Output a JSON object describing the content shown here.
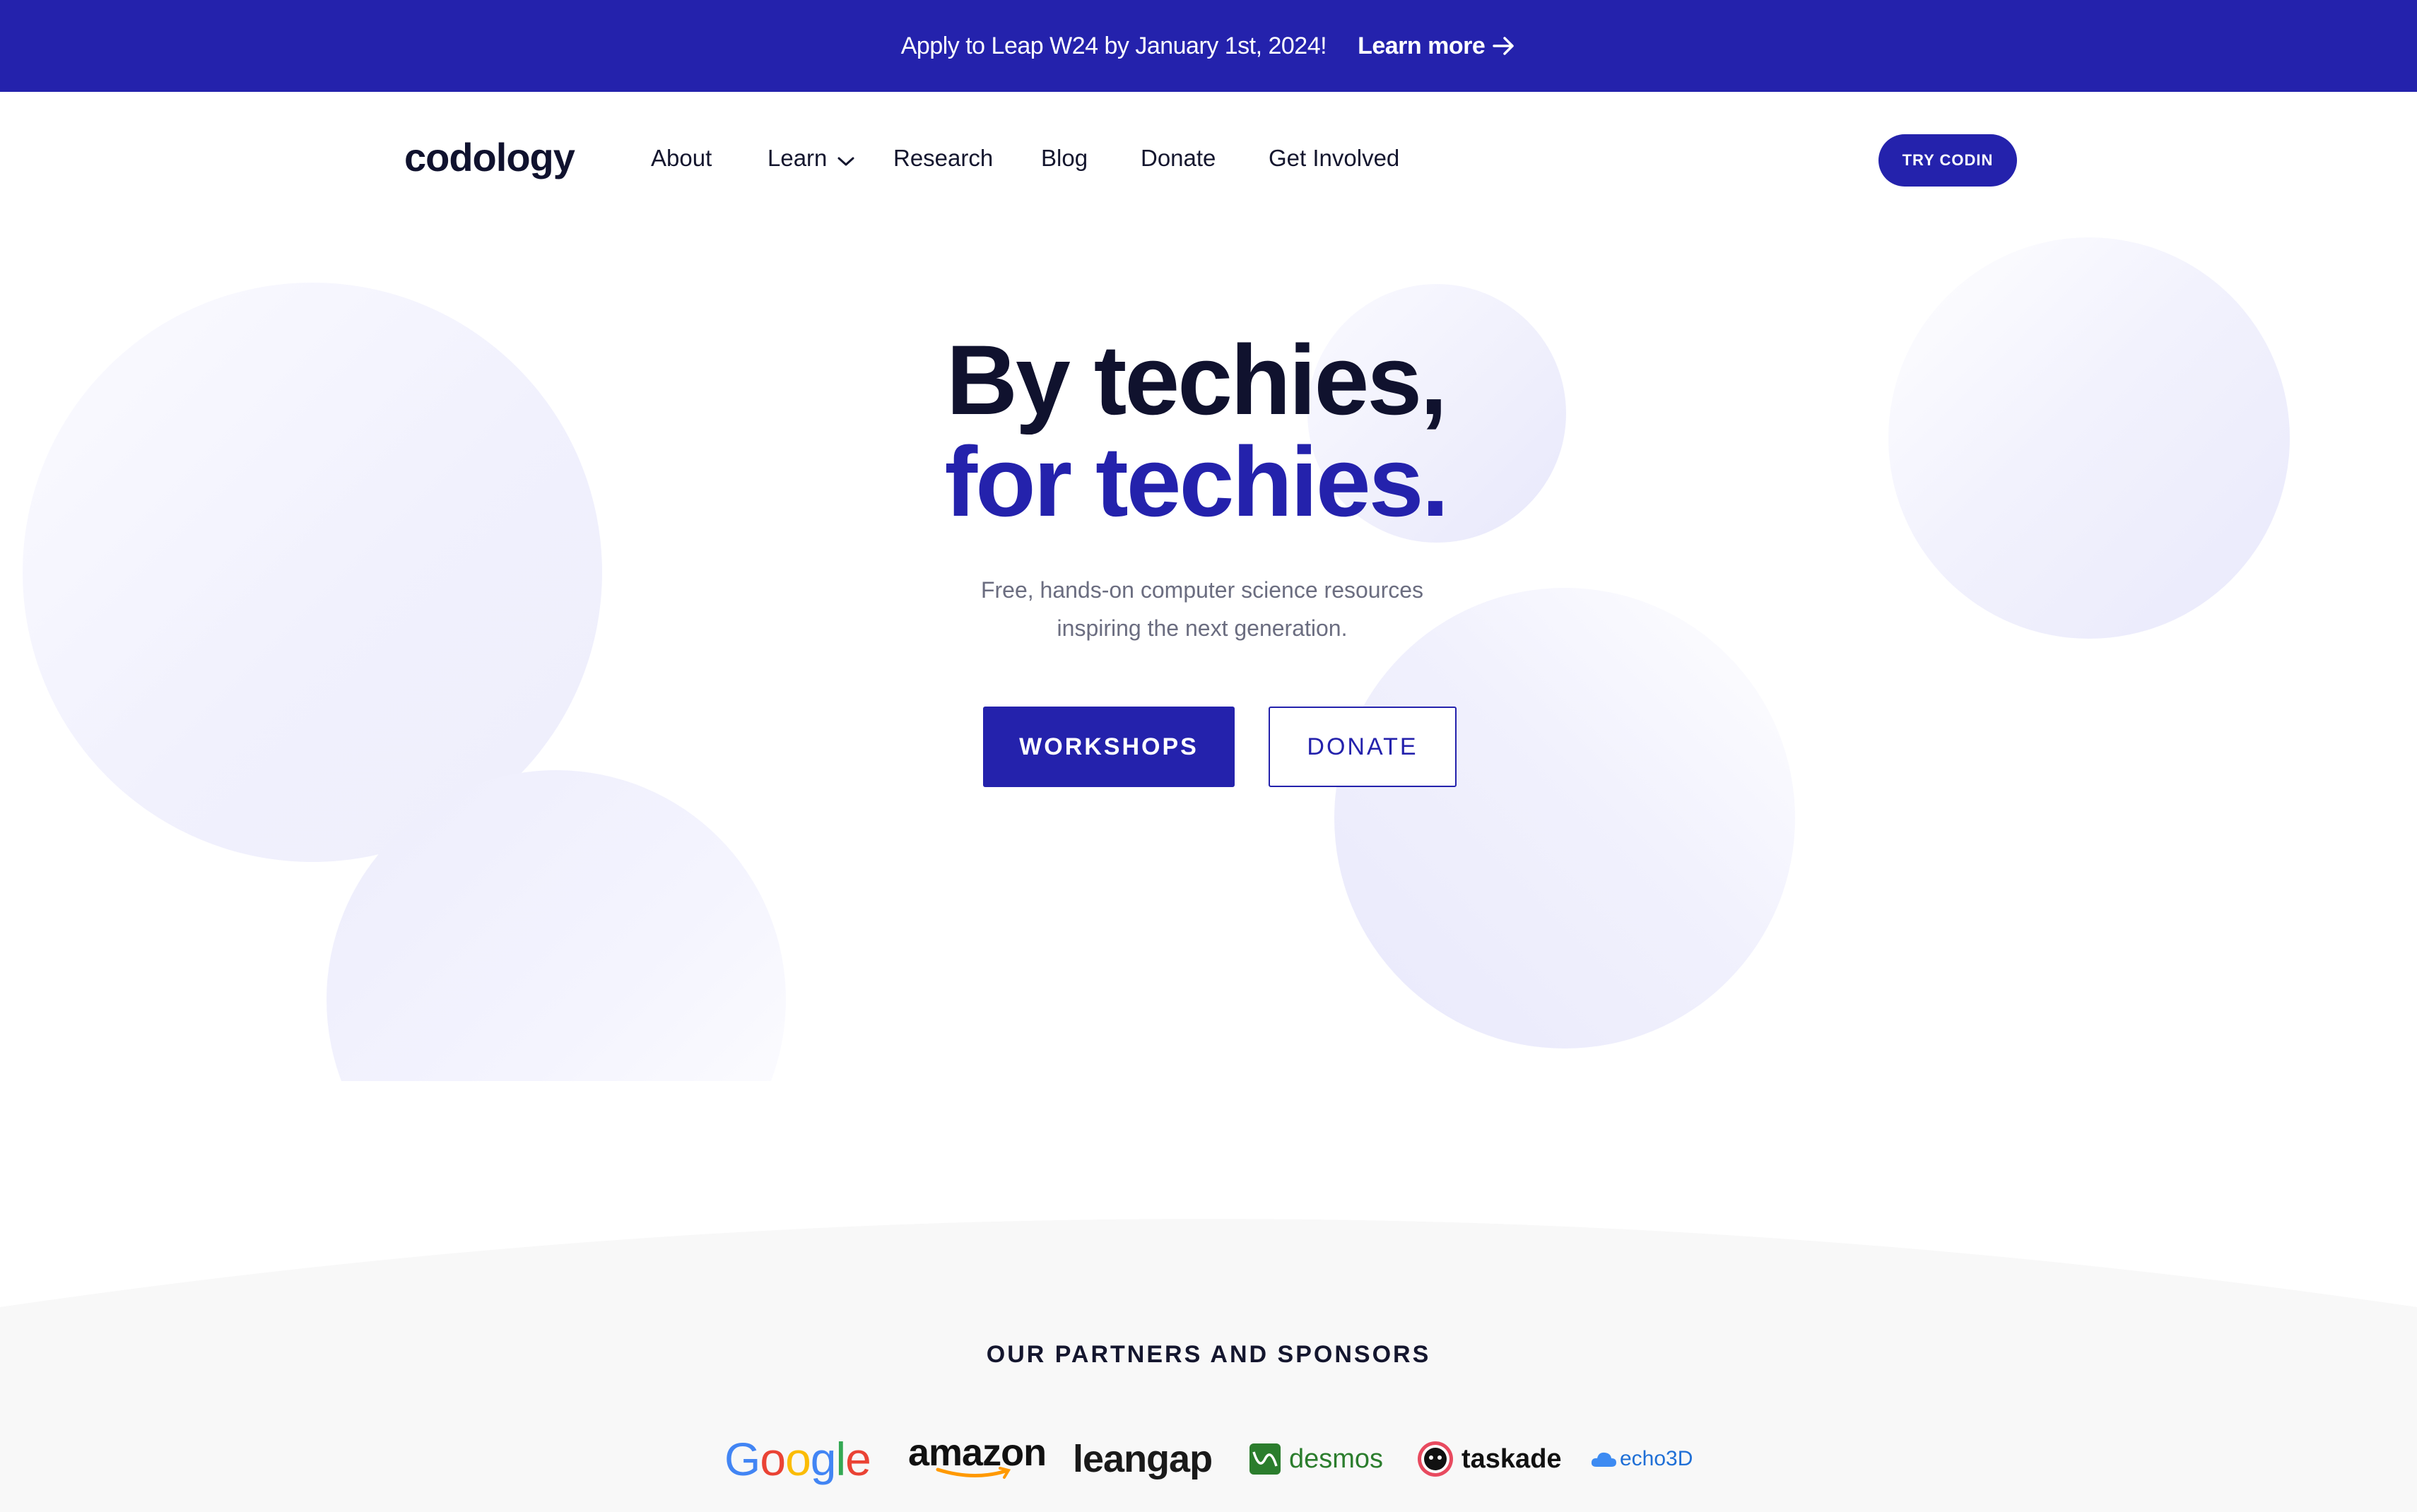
{
  "announcement": {
    "message": "Apply to Leap W24 by January 1st, 2024!",
    "link_label": "Learn more",
    "background": "#2422ac"
  },
  "header": {
    "logo": "codology",
    "nav": [
      {
        "label": "About"
      },
      {
        "label": "Learn",
        "has_dropdown": true
      },
      {
        "label": "Research"
      },
      {
        "label": "Blog"
      },
      {
        "label": "Donate"
      },
      {
        "label": "Get Involved"
      }
    ],
    "cta_label": "TRY CODIN"
  },
  "hero": {
    "title_line1": "By techies,",
    "title_line2": "for techies.",
    "subtitle_line1": "Free, hands-on computer science resources",
    "subtitle_line2": "inspiring the next generation.",
    "primary_button": "WORKSHOPS",
    "secondary_button": "DONATE"
  },
  "partners": {
    "title": "OUR PARTNERS AND SPONSORS",
    "logos": [
      "Google",
      "amazon",
      "leangap",
      "desmos",
      "taskade",
      "echo3D"
    ]
  },
  "colors": {
    "accent": "#2422ac",
    "heading": "#10122e",
    "muted_text": "#6b6d80",
    "partners_bg": "#f8f8f8"
  }
}
